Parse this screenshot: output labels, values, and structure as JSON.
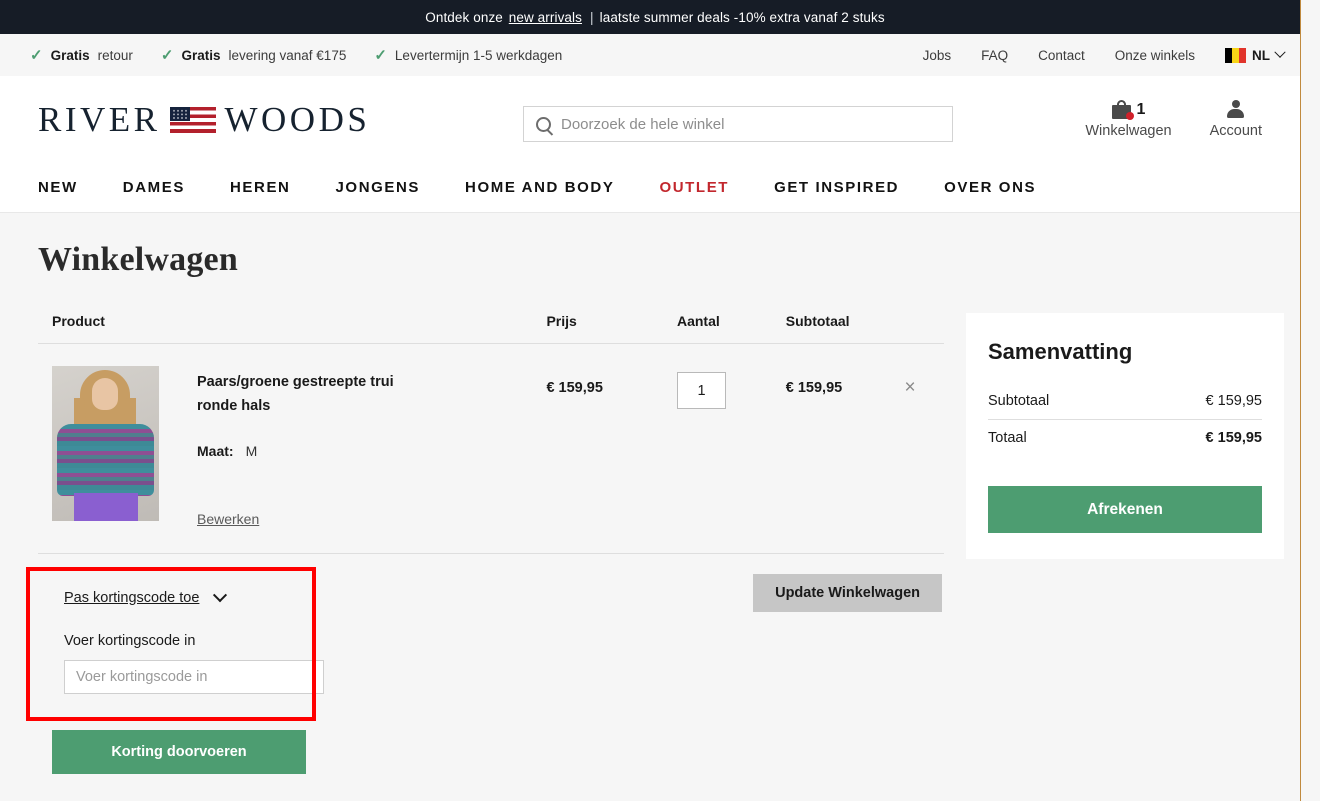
{
  "announcement": {
    "prefix": "Ontdek onze",
    "link": "new arrivals",
    "separator": "|",
    "suffix": "laatste summer deals -10% extra vanaf 2 stuks"
  },
  "utility_bar": {
    "usps": [
      {
        "bold": "Gratis",
        "rest": "retour"
      },
      {
        "bold": "Gratis",
        "rest": "levering vanaf €175"
      },
      {
        "bold": "",
        "rest": "Levertermijn 1-5 werkdagen"
      }
    ],
    "links": [
      "Jobs",
      "FAQ",
      "Contact",
      "Onze winkels"
    ],
    "language": {
      "code": "NL",
      "flag": "belgium-flag"
    }
  },
  "header": {
    "logo_left": "RIVER",
    "logo_right": "WOODS",
    "search_placeholder": "Doorzoek de hele winkel",
    "search_value": "",
    "cart_label": "Winkelwagen",
    "cart_count": "1",
    "account_label": "Account"
  },
  "nav": {
    "items": [
      {
        "label": "NEW",
        "active": false
      },
      {
        "label": "DAMES",
        "active": false
      },
      {
        "label": "HEREN",
        "active": false
      },
      {
        "label": "JONGENS",
        "active": false
      },
      {
        "label": "HOME AND BODY",
        "active": false
      },
      {
        "label": "OUTLET",
        "active": true
      },
      {
        "label": "GET INSPIRED",
        "active": false
      },
      {
        "label": "OVER ONS",
        "active": false
      }
    ]
  },
  "cart": {
    "page_title": "Winkelwagen",
    "columns": {
      "product": "Product",
      "price": "Prijs",
      "qty": "Aantal",
      "subtotal": "Subtotaal"
    },
    "items": [
      {
        "name": "Paars/groene gestreepte trui ronde hals",
        "option_label": "Maat:",
        "option_value": "M",
        "edit_label": "Bewerken",
        "price": "€ 159,95",
        "qty": "1",
        "subtotal": "€ 159,95",
        "remove_label": "×"
      }
    ],
    "coupon": {
      "toggle_label": "Pas kortingscode toe",
      "field_label": "Voer kortingscode in",
      "input_placeholder": "Voer kortingscode in",
      "input_value": "",
      "apply_label": "Korting doorvoeren"
    },
    "update_label": "Update Winkelwagen"
  },
  "summary": {
    "title": "Samenvatting",
    "subtotal_label": "Subtotaal",
    "subtotal_value": "€ 159,95",
    "total_label": "Totaal",
    "total_value": "€ 159,95",
    "checkout_label": "Afrekenen"
  },
  "colors": {
    "announce_bg": "#161c26",
    "accent_red": "#c2272d",
    "green": "#4d9d71",
    "gray_button": "#c6c6c6",
    "highlight_red": "#ff0000",
    "page_bg": "#f6f6f6"
  }
}
